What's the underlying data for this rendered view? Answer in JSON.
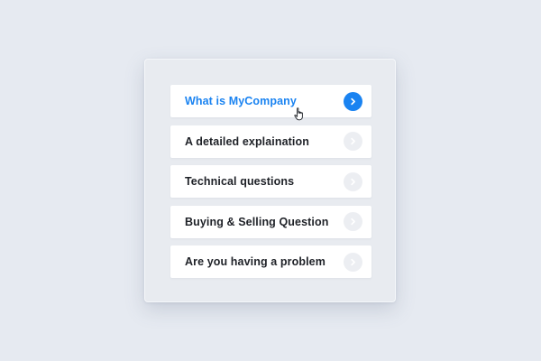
{
  "faq": {
    "items": [
      {
        "label": "What is MyCompany",
        "icon": "chevron-right-icon",
        "state": "active"
      },
      {
        "label": "A detailed explaination",
        "icon": "chevron-right-icon",
        "state": "inactive"
      },
      {
        "label": "Technical questions",
        "icon": "chevron-right-icon",
        "state": "inactive"
      },
      {
        "label": "Buying & Selling Question",
        "icon": "chevron-right-icon",
        "state": "inactive"
      },
      {
        "label": "Are you having a problem",
        "icon": "chevron-right-icon",
        "state": "inactive"
      }
    ]
  },
  "colors": {
    "accent": "#1a83f1",
    "text": "#1e2127",
    "background": "#e6eaf1",
    "card": "#e8ebf0",
    "inactive_button": "#eceef2"
  },
  "cursor": {
    "icon": "hand-pointer-icon"
  }
}
